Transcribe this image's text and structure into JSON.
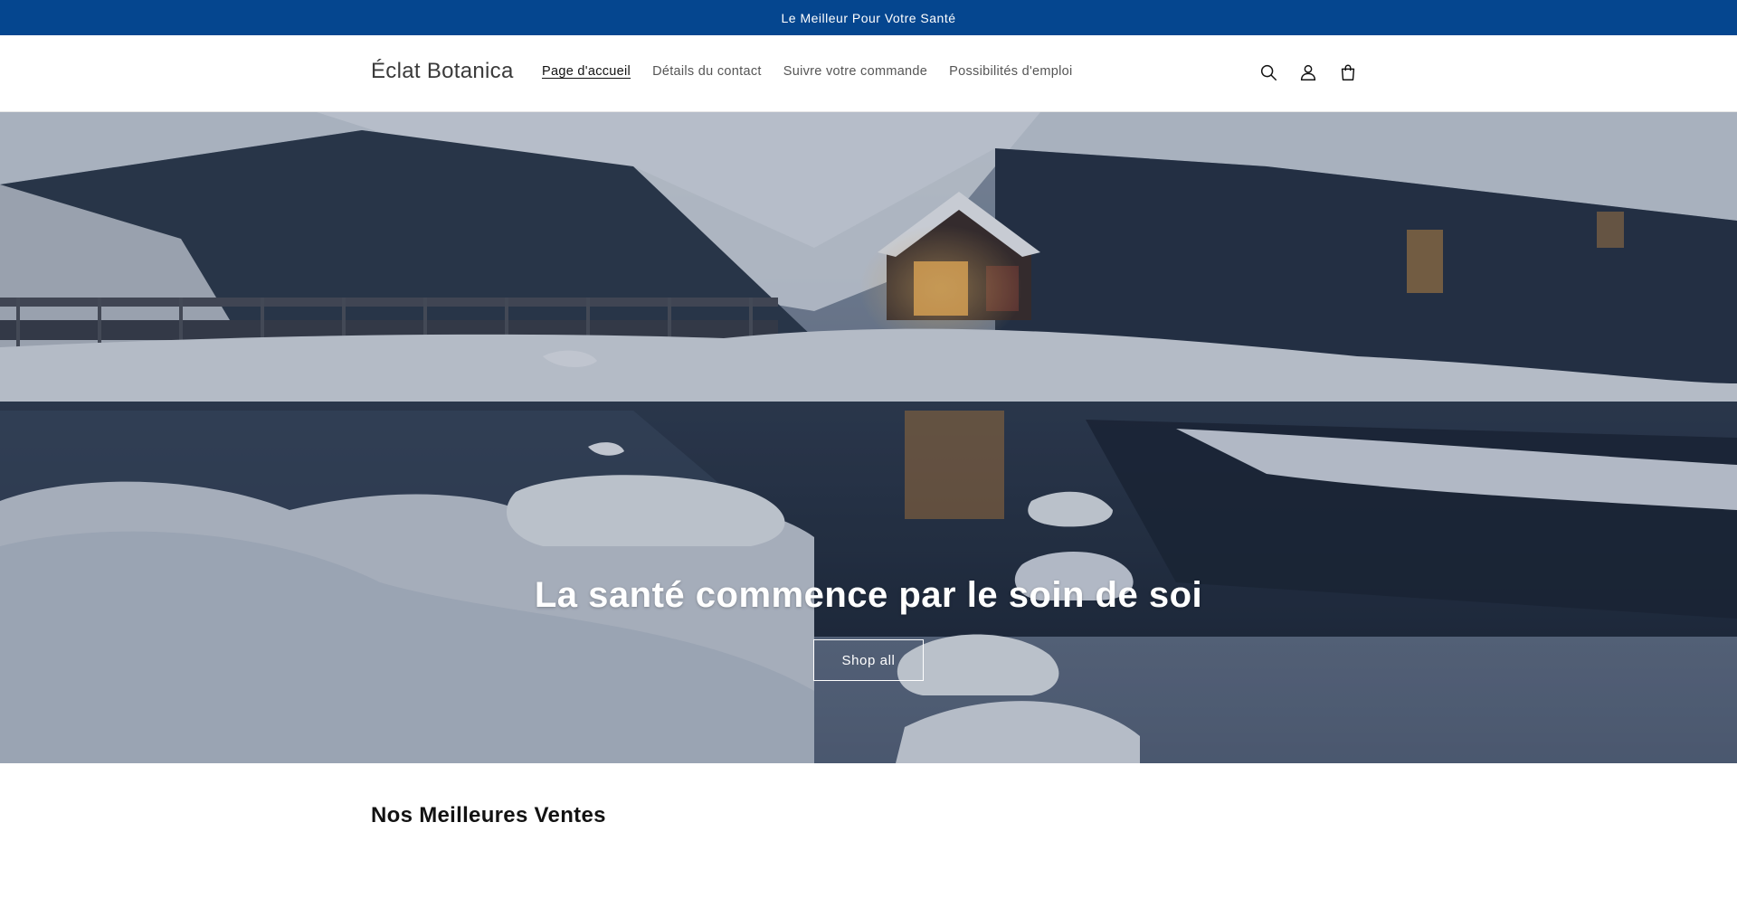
{
  "announcement": {
    "text": "Le Meilleur Pour Votre Santé"
  },
  "header": {
    "logo": "Éclat Botanica",
    "nav": [
      {
        "label": "Page d'accueil",
        "active": true
      },
      {
        "label": "Détails du contact",
        "active": false
      },
      {
        "label": "Suivre votre commande",
        "active": false
      },
      {
        "label": "Possibilités d'emploi",
        "active": false
      }
    ],
    "icons": [
      "search-icon",
      "account-icon",
      "cart-icon"
    ]
  },
  "hero": {
    "heading": "La santé commence par le soin de soi",
    "button_label": "Shop all",
    "image_description_icon": "snowy-lake-cabin-image"
  },
  "featured": {
    "title": "Nos Meilleures Ventes"
  },
  "colors": {
    "announcement_bg": "#05468f",
    "announcement_text": "#ffffff",
    "text": "#121212"
  }
}
